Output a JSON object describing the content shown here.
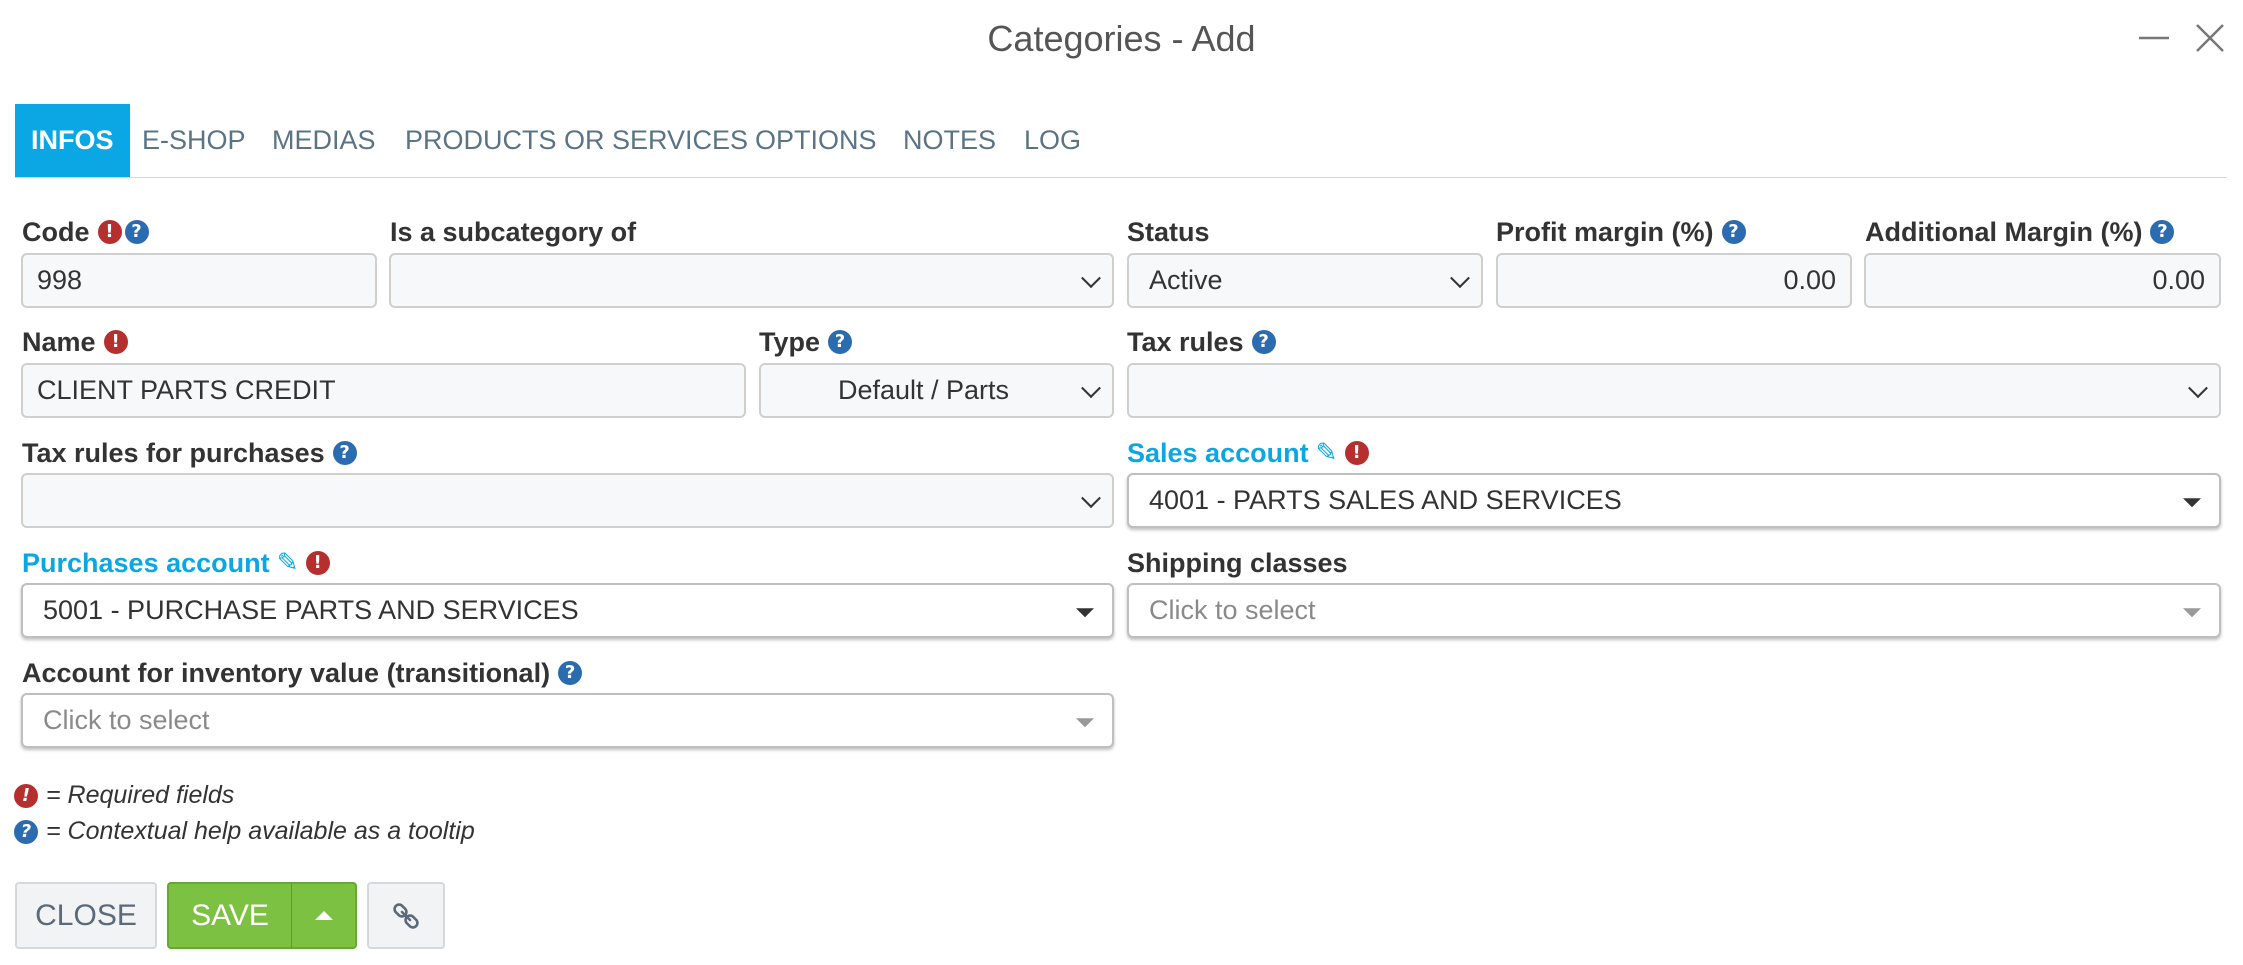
{
  "window": {
    "title": "Categories - Add"
  },
  "tabs": [
    {
      "label": "INFOS",
      "active": true
    },
    {
      "label": "E-SHOP"
    },
    {
      "label": "MEDIAS"
    },
    {
      "label": "PRODUCTS OR SERVICES"
    },
    {
      "label": "OPTIONS"
    },
    {
      "label": "NOTES"
    },
    {
      "label": "LOG"
    }
  ],
  "form": {
    "code": {
      "label": "Code",
      "value": "998"
    },
    "subcategory": {
      "label": "Is a subcategory of",
      "value": ""
    },
    "status": {
      "label": "Status",
      "value": "Active"
    },
    "profit_margin": {
      "label": "Profit margin (%)",
      "value": "0.00"
    },
    "additional_margin": {
      "label": "Additional Margin (%)",
      "value": "0.00"
    },
    "name": {
      "label": "Name",
      "value": "CLIENT PARTS CREDIT"
    },
    "type": {
      "label": "Type",
      "value": "Default / Parts"
    },
    "tax_rules": {
      "label": "Tax rules",
      "value": ""
    },
    "tax_rules_purchases": {
      "label": "Tax rules for purchases",
      "value": ""
    },
    "sales_account": {
      "label": "Sales account",
      "value": "4001 - PARTS SALES AND SERVICES"
    },
    "purchases_account": {
      "label": "Purchases account",
      "value": "5001 - PURCHASE PARTS AND SERVICES"
    },
    "shipping_classes": {
      "label": "Shipping classes",
      "placeholder": "Click to select"
    },
    "inventory_account": {
      "label": "Account for inventory value (transitional)",
      "placeholder": "Click to select"
    }
  },
  "legend": {
    "required": "= Required fields",
    "help": "= Contextual help available as a tooltip"
  },
  "buttons": {
    "close": "CLOSE",
    "save": "SAVE"
  },
  "icons": {
    "required": "exclamation-circle-icon",
    "help": "question-circle-icon",
    "edit": "edit-icon",
    "link": "link-icon",
    "minimize": "minimize-icon",
    "close": "close-icon"
  },
  "colors": {
    "accent": "#0aa7e4",
    "required": "#b52f2f",
    "help": "#2b6cb0",
    "save": "#7dc142"
  }
}
